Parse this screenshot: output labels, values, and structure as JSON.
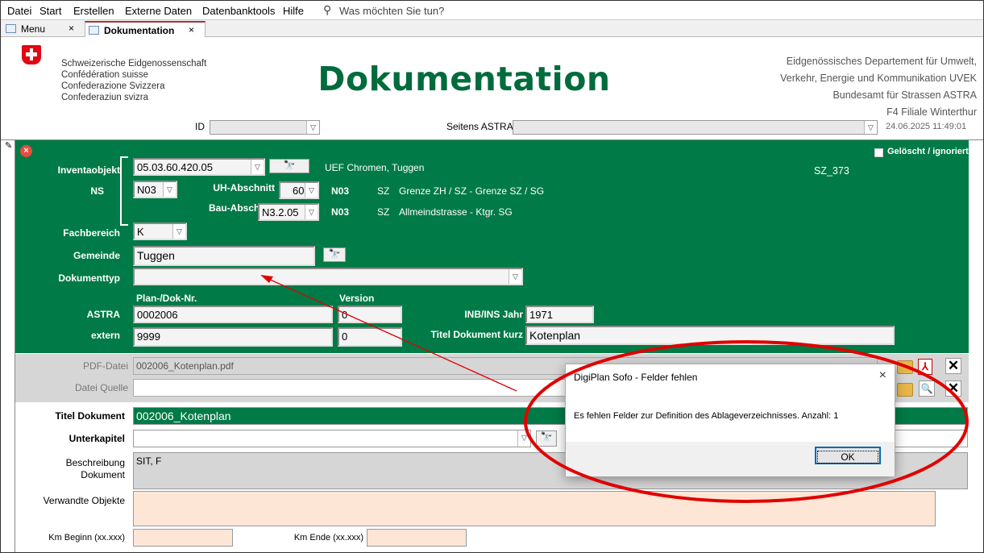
{
  "menu": {
    "items": [
      "Datei",
      "Start",
      "Erstellen",
      "Externe Daten",
      "Datenbanktools",
      "Hilfe"
    ],
    "search_placeholder": "Was möchten Sie tun?"
  },
  "tabs": [
    {
      "label": "Menu",
      "close": "×"
    },
    {
      "label": "Dokumentation",
      "close": "×"
    }
  ],
  "header": {
    "confed": [
      "Schweizerische Eidgenossenschaft",
      "Confédération suisse",
      "Confederazione Svizzera",
      "Confederaziun svizra"
    ],
    "title": "Dokumentation",
    "dept": [
      "Eidgenössisches Departement für Umwelt,",
      "Verkehr, Energie und Kommunikation UVEK",
      "Bundesamt für Strassen ASTRA",
      "F4 Filiale Winterthur"
    ],
    "id_label": "ID",
    "id_value": "",
    "seitens_label": "Seitens ASTRA",
    "seitens_value": "",
    "datetime": "24.06.2025 11:49:01"
  },
  "form": {
    "inventaobjekt_label": "Inventaobjekt",
    "inventaobjekt_value": "05.03.60.420.05",
    "inventaobjekt_name": "UEF Chromen, Tuggen",
    "sz_code": "SZ_373",
    "geloescht_label": "Gelöscht / ignoriert",
    "ns_label": "NS",
    "ns_value": "N03",
    "uh_label": "UH-Abschnitt",
    "uh_value": "60",
    "uh_n": "N03",
    "uh_kanton": "SZ",
    "uh_text": "Grenze ZH / SZ - Grenze SZ / SG",
    "bau_label": "Bau-Abschnitt",
    "bau_value": "N3.2.05",
    "bau_n": "N03",
    "bau_kanton": "SZ",
    "bau_text": "Allmeindstrasse - Ktgr. SG",
    "fachbereich_label": "Fachbereich",
    "fachbereich_value": "K",
    "gemeinde_label": "Gemeinde",
    "gemeinde_value": "Tuggen",
    "dokumenttyp_label": "Dokumenttyp",
    "dokumenttyp_value": "",
    "plan_header": "Plan-/Dok-Nr.",
    "version_header": "Version",
    "astra_label": "ASTRA",
    "astra_value": "0002006",
    "astra_version": "0",
    "extern_label": "extern",
    "extern_value": "9999",
    "extern_version": "0",
    "inb_label": "INB/INS Jahr",
    "inb_value": "1971",
    "titel_kurz_label": "Titel Dokument kurz",
    "titel_kurz_value": "Kotenplan"
  },
  "files": {
    "pdf_label": "PDF-Datei",
    "pdf_value": "002006_Kotenplan.pdf",
    "quelle_label": "Datei Quelle",
    "quelle_value": ""
  },
  "details": {
    "titel_label": "Titel Dokument",
    "titel_value": "002006_Kotenplan",
    "unterkapitel_label": "Unterkapitel",
    "unterkapitel_value": "",
    "beschreibung_label1": "Beschreibung",
    "beschreibung_label2": "Dokument",
    "beschreibung_value": "SIT, F",
    "verwandte_label": "Verwandte Objekte",
    "km_beginn_label": "Km Beginn (xx.xxx)",
    "km_ende_label": "Km Ende (xx.xxx)"
  },
  "dialog": {
    "title": "DigiPlan Sofo - Felder fehlen",
    "message": "Es fehlen Felder zur Definition des Ablageverzeichnisses. Anzahl: 1",
    "ok": "OK",
    "close": "×"
  },
  "colors": {
    "green": "#007a46",
    "title_green": "#006b3c",
    "annotation_red": "#e00000"
  }
}
